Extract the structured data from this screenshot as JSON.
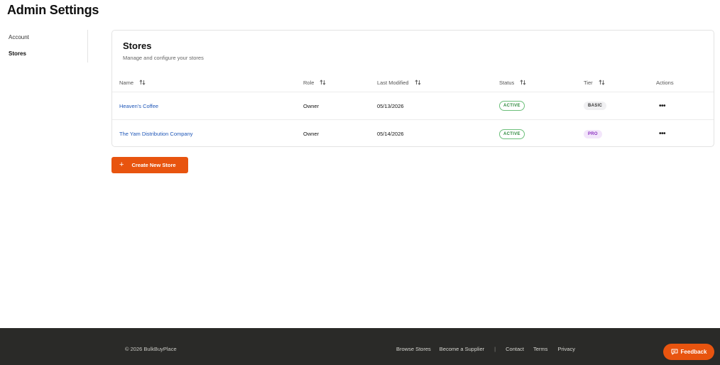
{
  "header": {
    "title": "Admin Settings"
  },
  "sidebar": {
    "items": [
      {
        "label": "Account",
        "active": false
      },
      {
        "label": "Stores",
        "active": true
      }
    ]
  },
  "stores_card": {
    "title": "Stores",
    "subtitle": "Manage and configure your stores",
    "columns": [
      "Name",
      "Role",
      "Last Modified",
      "Status",
      "Tier",
      "Actions"
    ],
    "rows": [
      {
        "name": "Heaven's Coffee",
        "role": "Owner",
        "last_modified": "05/13/2026",
        "status": "ACTIVE",
        "tier": "BASIC"
      },
      {
        "name": "The Yam Distribution Company",
        "role": "Owner",
        "last_modified": "05/14/2026",
        "status": "ACTIVE",
        "tier": "PRO"
      }
    ]
  },
  "create_button": {
    "label": "Create New Store",
    "icon": "plus-icon"
  },
  "footer": {
    "copyright": "© 2026 BulkBuyPlace",
    "links": [
      "Browse Stores",
      "Become a Supplier",
      "Contact",
      "Terms",
      "Privacy"
    ],
    "separator": "|"
  },
  "feedback_button": {
    "label": "Feedback",
    "icon": "chat-icon"
  },
  "colors": {
    "accent": "#e8540f",
    "link": "#1f57b8",
    "active_status": "#2f8a3e",
    "pro_badge": "#8a2fc0",
    "footer_bg": "#2a2a28"
  }
}
